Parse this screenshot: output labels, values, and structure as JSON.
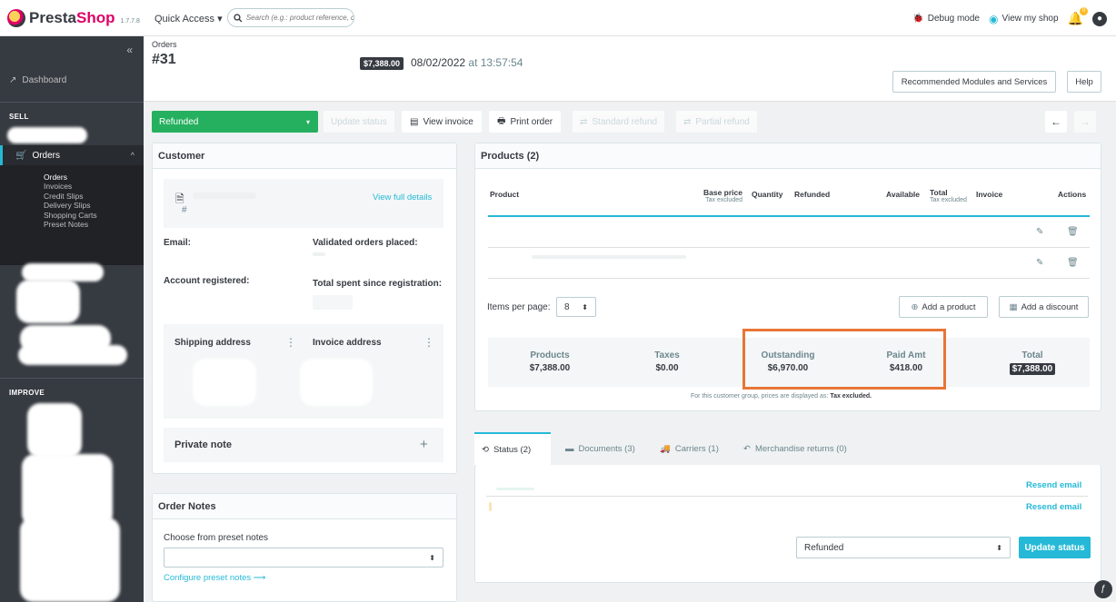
{
  "topbar": {
    "brand_prefix": "Presta",
    "brand_suffix": "Shop",
    "version": "1.7.7.8",
    "quick_access": "Quick Access ▾",
    "search_placeholder": "Search (e.g.: product reference, custome",
    "debug_mode": "Debug mode",
    "view_shop": "View my shop",
    "notification_count": "0"
  },
  "sidebar": {
    "collapse": "«",
    "dashboard": "Dashboard",
    "sell_section": "SELL",
    "orders": "Orders",
    "sub_items": [
      "Orders",
      "Invoices",
      "Credit Slips",
      "Delivery Slips",
      "Shopping Carts",
      "Preset Notes"
    ],
    "improve_section": "IMPROVE"
  },
  "header": {
    "breadcrumb": "Orders",
    "order_number": "#31",
    "total_badge": "$7,388.00",
    "date": "08/02/2022",
    "at_time": "at 13:57:54",
    "recommended": "Recommended Modules and Services",
    "help": "Help"
  },
  "toolbar": {
    "status": "Refunded",
    "update_status": "Update status",
    "view_invoice": "View invoice",
    "print_order": "Print order",
    "standard_refund": "Standard refund",
    "partial_refund": "Partial refund",
    "prev": "←",
    "next": "→"
  },
  "customer": {
    "title": "Customer",
    "hash": "#",
    "view_full": "View full details",
    "email_label": "Email:",
    "validated_label": "Validated orders placed:",
    "account_label": "Account registered:",
    "total_spent_label": "Total spent since registration:",
    "shipping_label": "Shipping address",
    "invoice_label": "Invoice address",
    "private_note": "Private note",
    "plus": "+"
  },
  "order_notes": {
    "title": "Order Notes",
    "choose_label": "Choose from preset notes",
    "configure": "Configure preset notes ⟶"
  },
  "products": {
    "title": "Products (2)",
    "columns": {
      "product": "Product",
      "base_price": "Base price",
      "base_price_sub": "Tax excluded",
      "quantity": "Quantity",
      "refunded": "Refunded",
      "available": "Available",
      "total": "Total",
      "total_sub": "Tax excluded",
      "invoice": "Invoice",
      "actions": "Actions"
    },
    "items_per_page_label": "Items per page:",
    "items_per_page": "8",
    "add_product": "Add a product",
    "add_discount": "Add a discount",
    "summary": {
      "products_label": "Products",
      "products_value": "$7,388.00",
      "taxes_label": "Taxes",
      "taxes_value": "$0.00",
      "outstanding_label": "Outstanding",
      "outstanding_value": "$6,970.00",
      "paid_label": "Paid Amt",
      "paid_value": "$418.00",
      "total_label": "Total",
      "total_value": "$7,388.00"
    },
    "footnote_prefix": "For this customer group, prices are displayed as:",
    "footnote_bold": "Tax excluded."
  },
  "tabs": {
    "status": "Status (2)",
    "documents": "Documents (3)",
    "carriers": "Carriers (1)",
    "returns": "Merchandise returns (0)"
  },
  "status_panel": {
    "resend1": "Resend email",
    "resend2": "Resend email",
    "selected_status": "Refunded",
    "update_status": "Update status"
  },
  "colors": {
    "accent": "#25b9d7",
    "success": "#25b05f",
    "dark": "#363a41",
    "highlight": "#e87536"
  }
}
